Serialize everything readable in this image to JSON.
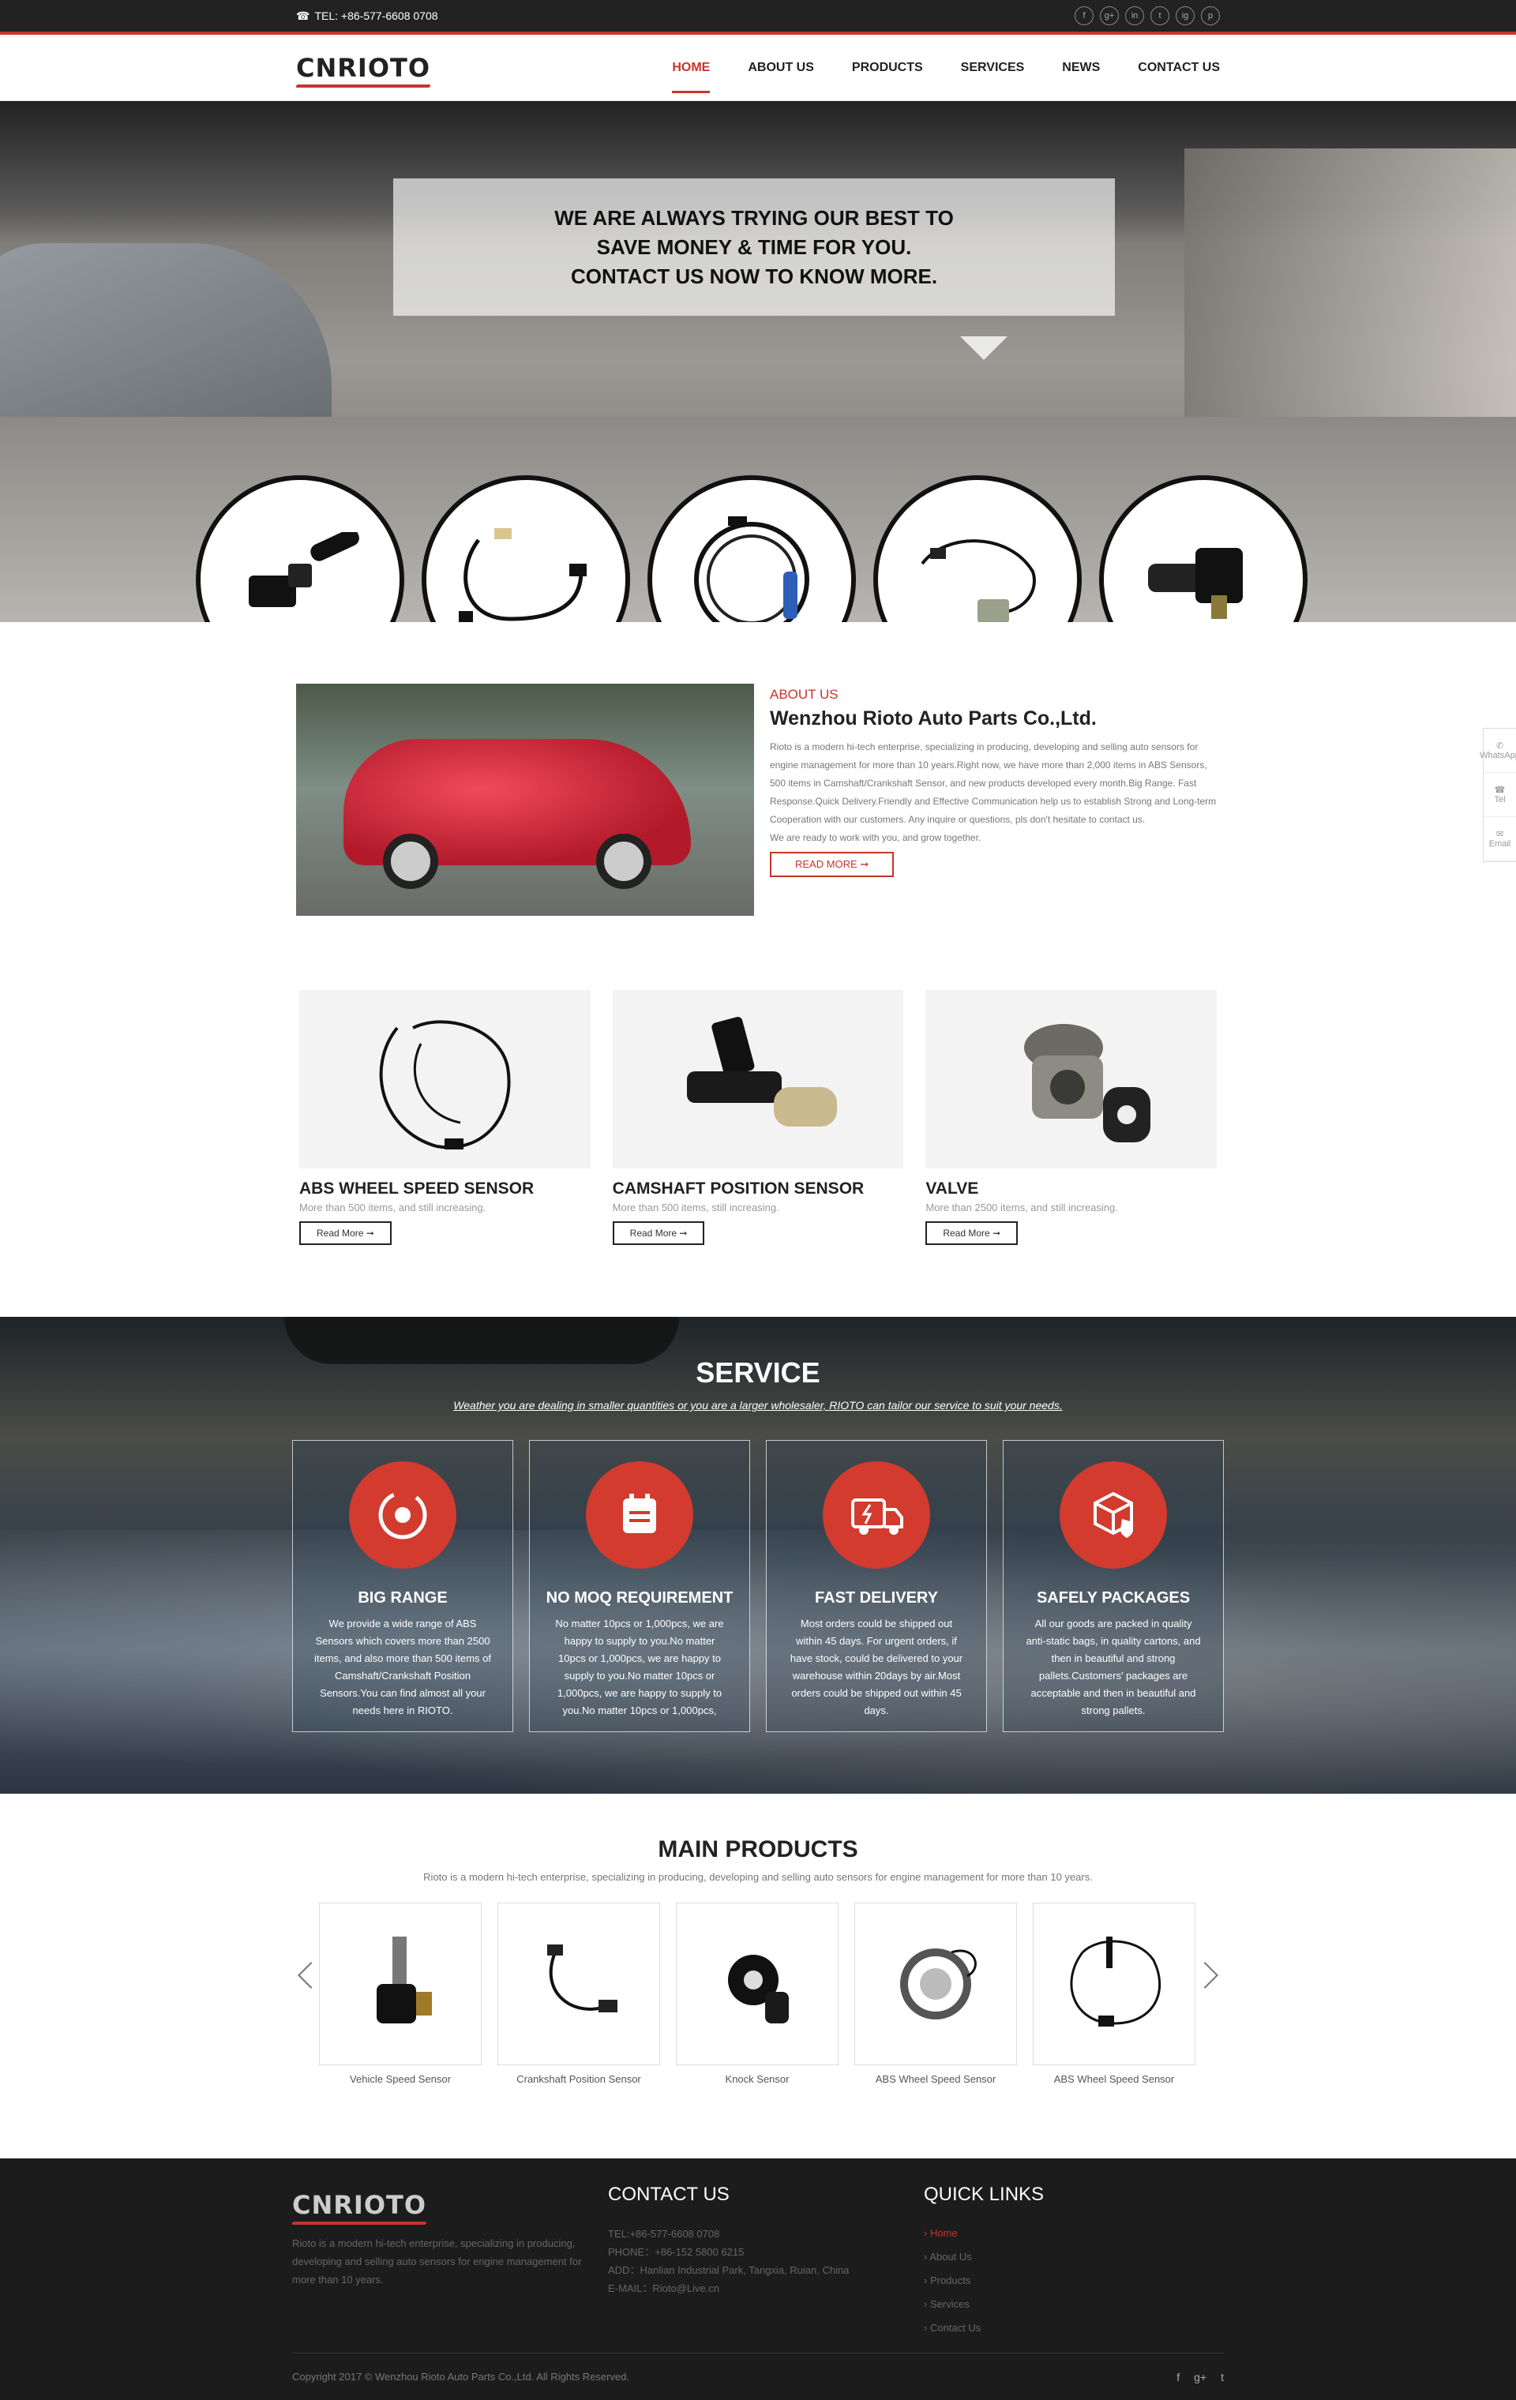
{
  "topbar": {
    "tel": "TEL: +86-577-6608 0708",
    "social": [
      "f",
      "g+",
      "in",
      "t",
      "ig",
      "p"
    ]
  },
  "header": {
    "logo": "CNRIOTO",
    "nav": [
      "HOME",
      "ABOUT US",
      "PRODUCTS",
      "SERVICES",
      "NEWS",
      "CONTACT US"
    ]
  },
  "hero": {
    "lines": [
      "WE ARE ALWAYS TRYING OUR BEST TO",
      "SAVE MONEY & TIME FOR YOU.",
      "CONTACT US NOW TO KNOW MORE."
    ]
  },
  "side": {
    "items": [
      "WhatsApp",
      "Tel",
      "Email"
    ]
  },
  "about": {
    "label": "ABOUT US",
    "title": "Wenzhou Rioto Auto Parts Co.,Ltd.",
    "body": "Rioto is a modern hi-tech enterprise, specializing in producing, developing and selling auto sensors for engine management for more than 10 years.Right now, we have more than 2,000 items in ABS Sensors, 500 items in Camshaft/Crankshaft Sensor, and new products developed every month.Big Range. Fast Response.Quick Delivery.Friendly and Effective Communication help us to establish Strong and Long-term Cooperation with our customers. Any inquire or questions, pls don't hesitate to contact us.",
    "body2": "We are ready to work with you, and grow together.",
    "button": "READ MORE ➞"
  },
  "categories": [
    {
      "title": "ABS WHEEL SPEED SENSOR",
      "sub": "More than 500 items, and still increasing.",
      "button": "Read More ➞"
    },
    {
      "title": "CAMSHAFT POSITION SENSOR",
      "sub": "More than 500 items, still increasing.",
      "button": "Read More ➞"
    },
    {
      "title": "VALVE",
      "sub": "More than 2500 items, and still increasing.",
      "button": "Read More ➞"
    }
  ],
  "service": {
    "title": "SERVICE",
    "subtitle": "Weather you are dealing in smaller quantities or you are a larger wholesaler, RIOTO can tailor our service to suit your needs.",
    "cards": [
      {
        "title": "BIG RANGE",
        "text": "We provide a wide range of ABS Sensors which covers more than 2500 items, and also more than 500 items of Camshaft/Crankshaft Position Sensors.You can find almost all your needs here in RIOTO."
      },
      {
        "title": "NO MOQ REQUIREMENT",
        "text": "No matter 10pcs or 1,000pcs, we are happy to supply to you.No matter 10pcs or 1,000pcs, we are happy to supply to you.No matter 10pcs or 1,000pcs, we are happy to supply to you.No matter 10pcs or 1,000pcs,"
      },
      {
        "title": "FAST DELIVERY",
        "text": "Most orders could be shipped out within 45 days. For urgent orders, if have stock, could be delivered to your warehouse within 20days by air.Most orders could be shipped out within 45 days."
      },
      {
        "title": "SAFELY PACKAGES",
        "text": "All our goods are packed in quality anti-static bags, in quality cartons, and then in beautiful and strong pallets.Customers' packages are acceptable and then in beautiful and strong pallets."
      }
    ]
  },
  "main_products": {
    "title": "MAIN PRODUCTS",
    "subtitle": "Rioto is a modern hi-tech enterprise, specializing in producing, developing and selling auto sensors for engine management for more than 10 years.",
    "items": [
      "Vehicle Speed Sensor",
      "Crankshaft Position Sensor",
      "Knock Sensor",
      "ABS Wheel Speed Sensor",
      "ABS Wheel Speed Sensor"
    ]
  },
  "footer": {
    "logo": "CNRIOTO",
    "desc": "Rioto is a modern hi-tech enterprise, specializing in producing, developing and selling auto sensors for engine management for more than 10 years.",
    "contact_title": "CONTACT US",
    "contact": [
      "TEL:+86-577-6608 0708",
      "PHONE：+86-152 5800 6215",
      "ADD：Hanlian Industrial Park, Tangxia, Ruian, China",
      "E-MAIL：Rioto@Live.cn"
    ],
    "links_title": "QUICK LINKS",
    "links": [
      "Home",
      "About Us",
      "Products",
      "Services",
      "Contact Us"
    ],
    "copyright": "Copyright 2017 © Wenzhou Rioto Auto Parts Co.,Ltd. All Rights Reserved.",
    "social": [
      "f",
      "g+",
      "t"
    ]
  }
}
